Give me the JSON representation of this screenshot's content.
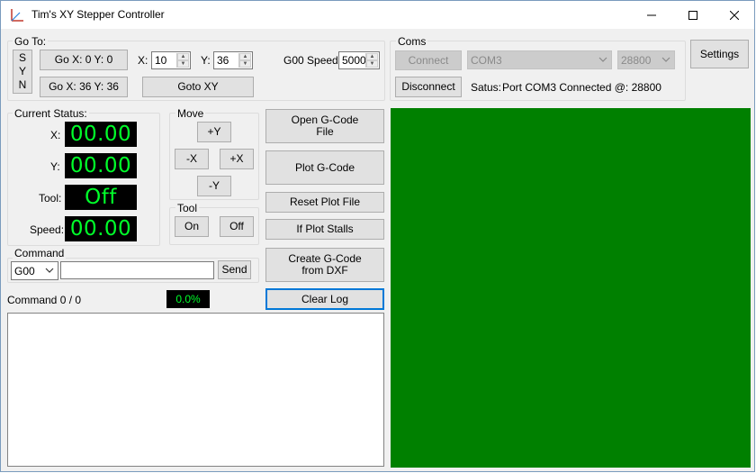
{
  "window": {
    "title": "Tim's XY Stepper Controller"
  },
  "goto": {
    "group_label": "Go To:",
    "syn_letters": [
      "S",
      "Y",
      "N"
    ],
    "go_origin_label": "Go X: 0 Y: 0",
    "go_max_label": "Go X: 36 Y: 36",
    "x_label": "X:",
    "x_value": "10",
    "y_label": "Y:",
    "y_value": "36",
    "goto_xy_label": "Goto  XY",
    "g00_speed_label": "G00 Speed:",
    "g00_speed_value": "5000"
  },
  "coms": {
    "group_label": "Coms",
    "connect_label": "Connect",
    "port_value": "COM3",
    "baud_value": "28800",
    "disconnect_label": "Disconnect",
    "status_label": "Satus:",
    "status_text": "Port COM3 Connected @: 28800"
  },
  "settings_label": "Settings",
  "status": {
    "group_label": "Current Status:",
    "x_label": "X:",
    "x_value": "00.00",
    "y_label": "Y:",
    "y_value": "00.00",
    "tool_label": "Tool:",
    "tool_value": "Off",
    "speed_label": "Speed:",
    "speed_value": "00.00"
  },
  "move": {
    "group_label": "Move",
    "up_label": "+Y",
    "left_label": "-X",
    "right_label": "+X",
    "down_label": "-Y"
  },
  "tool": {
    "group_label": "Tool",
    "on_label": "On",
    "off_label": "Off"
  },
  "actions": {
    "open_gcode_label": "Open G-Code\nFile",
    "plot_gcode_label": "Plot G-Code",
    "reset_plot_label": "Reset Plot File",
    "if_plot_stalls_label": "If Plot Stalls",
    "create_gcode_label": "Create G-Code\nfrom DXF",
    "clear_log_label": "Clear Log"
  },
  "command": {
    "group_label": "Command",
    "select_value": "G00",
    "input_value": "",
    "send_label": "Send",
    "counter_text": "Command 0 / 0",
    "progress_text": "0.0%",
    "progress_fraction": 0.0
  },
  "colors": {
    "plot_area": "#008000",
    "lcd_background": "#000000",
    "lcd_text": "#00ff2a",
    "focus_border": "#0078d7"
  }
}
